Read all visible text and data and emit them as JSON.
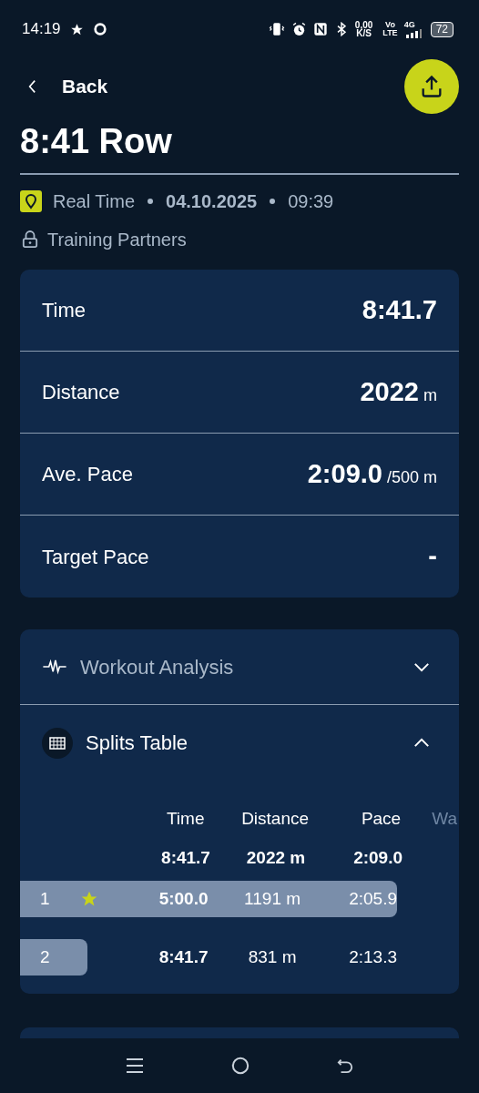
{
  "status_bar": {
    "time": "14:19",
    "net_speed": "0,00",
    "net_unit": "K/S",
    "volte_top": "Vo",
    "volte_bottom": "LTE",
    "network": "4G",
    "battery": "72"
  },
  "header": {
    "back_label": "Back",
    "title": "8:41 Row"
  },
  "meta": {
    "source": "Real Time",
    "date": "04.10.2025",
    "time": "09:39",
    "privacy": "Training Partners"
  },
  "stats": [
    {
      "label": "Time",
      "value": "8:41.7"
    },
    {
      "label": "Distance",
      "value": "2022",
      "unit": "m"
    },
    {
      "label": "Ave. Pace",
      "value": "2:09.0",
      "unit": "/500 m"
    },
    {
      "label": "Target Pace",
      "value": "-"
    }
  ],
  "sections": [
    {
      "title": "Workout Analysis",
      "expanded": false
    },
    {
      "title": "Splits Table",
      "expanded": true
    }
  ],
  "splits": {
    "columns": [
      "Time",
      "Distance",
      "Pace",
      "Wa"
    ],
    "totals": [
      "8:41.7",
      "2022 m",
      "2:09.0"
    ],
    "rows": [
      {
        "index": "1",
        "starred": true,
        "highlighted": true,
        "cells": [
          "5:00.0",
          "1191 m",
          "2:05.9"
        ]
      },
      {
        "index": "2",
        "starred": false,
        "highlighted": false,
        "cells": [
          "8:41.7",
          "831 m",
          "2:13.3"
        ]
      }
    ]
  }
}
